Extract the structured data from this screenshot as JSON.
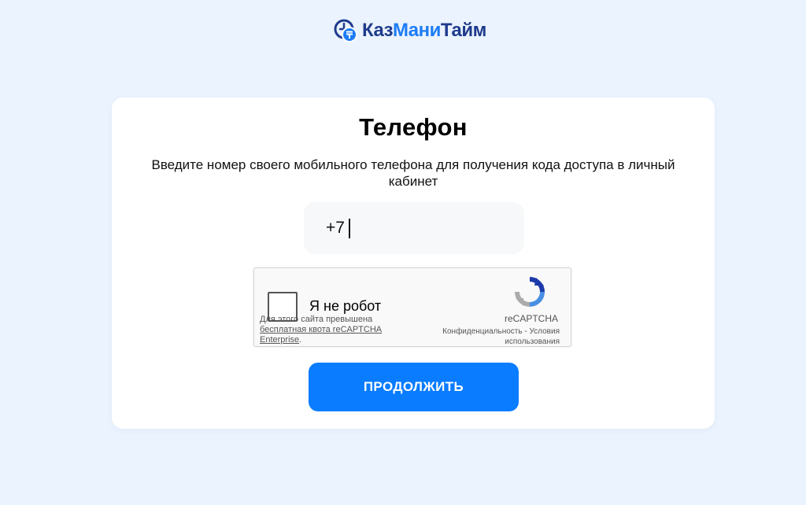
{
  "brand": {
    "part_dark_1": "Каз",
    "part_blue": "Мани",
    "part_dark_2": "Тайм",
    "color_dark": "#1f3b8c",
    "color_blue": "#1d7df5"
  },
  "form": {
    "title": "Телефон",
    "subtitle": "Введите номер своего мобильного телефона для получения кода доступа в личный кабинет",
    "phone_value": "+7",
    "submit_label": "ПРОДОЛЖИТЬ",
    "accent_color": "#0a7cff"
  },
  "captcha": {
    "checkbox_label": "Я не робот",
    "quota_text": "Для этого сайта превышена",
    "quota_link": "бесплатная квота reCAPTCHA Enterprise",
    "quota_end": ".",
    "brand": "reCAPTCHA",
    "privacy": "Конфиденциальность",
    "separator": " - ",
    "terms": "Условия использования",
    "logo_icon": "recaptcha-logo-icon"
  },
  "icons": {
    "logo": "clock-tenge-icon"
  }
}
